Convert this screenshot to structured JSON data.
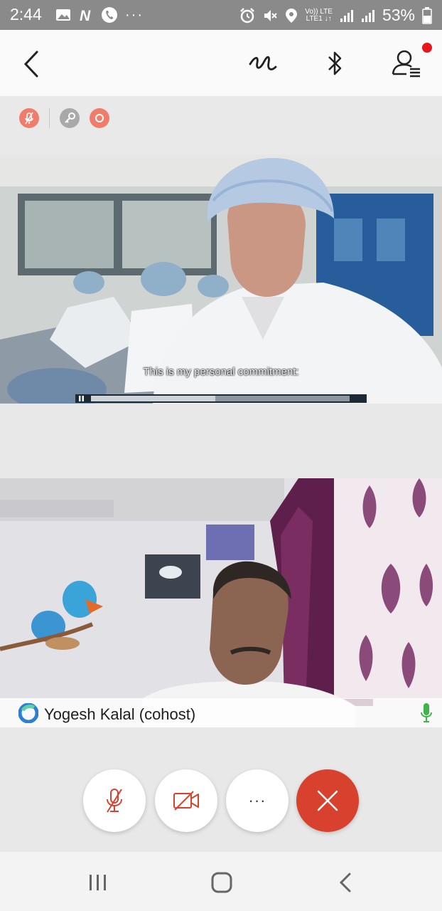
{
  "status_bar": {
    "time": "2:44",
    "network_top": "Vo)) LTE",
    "network_bottom": "LTE1 ↓↑",
    "battery": "53%"
  },
  "video": {
    "caption": "This is my personal commitment:"
  },
  "participant": {
    "name": "Yogesh Kalal (cohost)"
  },
  "call_controls": {
    "more_label": "···"
  },
  "colors": {
    "accent": "#d8412e",
    "chip_red": "#f07d6b",
    "mic_green": "#3db54a"
  }
}
